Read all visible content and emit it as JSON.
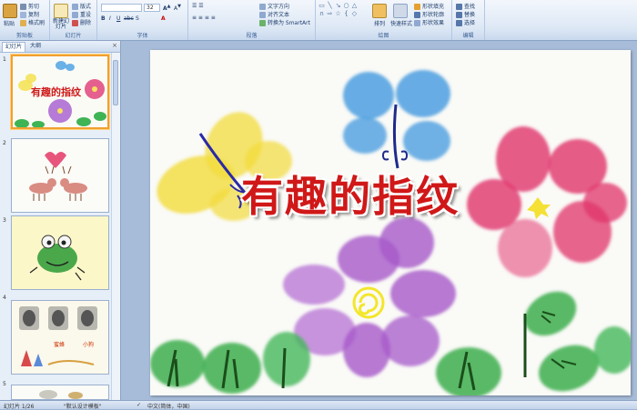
{
  "ribbon": {
    "clipboard": {
      "paste": "粘贴",
      "cut": "剪切",
      "copy": "复制",
      "format_painter": "格式刷",
      "label": "剪贴板"
    },
    "slides": {
      "new_slide": "新建幻灯片",
      "layout": "版式",
      "reset": "重设",
      "delete": "删除",
      "label": "幻灯片"
    },
    "font": {
      "font_name": "",
      "font_size": "32",
      "label": "字体"
    },
    "paragraph": {
      "text_direction": "文字方向",
      "align_text": "对齐文本",
      "convert_smartart": "转换为 SmartArt",
      "label": "段落"
    },
    "drawing": {
      "arrange": "排列",
      "quick_styles": "快速样式",
      "shape_fill": "形状填充",
      "shape_outline": "形状轮廓",
      "shape_effects": "形状效果",
      "label": "绘图"
    },
    "editing": {
      "find": "查找",
      "replace": "替换",
      "select": "选择",
      "label": "编辑"
    }
  },
  "panel": {
    "tabs": [
      "幻灯片",
      "大纲"
    ],
    "slide_numbers": [
      "1",
      "2",
      "3",
      "4",
      "5"
    ],
    "thumbnails": [
      {
        "caption": "有趣的指纹"
      },
      {
        "caption": ""
      },
      {
        "caption": ""
      },
      {
        "labels": [
          "蜜蜂",
          "小狗"
        ]
      },
      {
        "caption": ""
      }
    ]
  },
  "slide": {
    "title": "有趣的指纹"
  },
  "status": {
    "slide_counter": "幻灯片 1/26",
    "theme": "\"默认设计模板\"",
    "language": "中文(简体，中国)"
  },
  "colors": {
    "title_red": "#d01818",
    "ribbon_bg": "#dde8f5",
    "selection": "#f0a030"
  }
}
